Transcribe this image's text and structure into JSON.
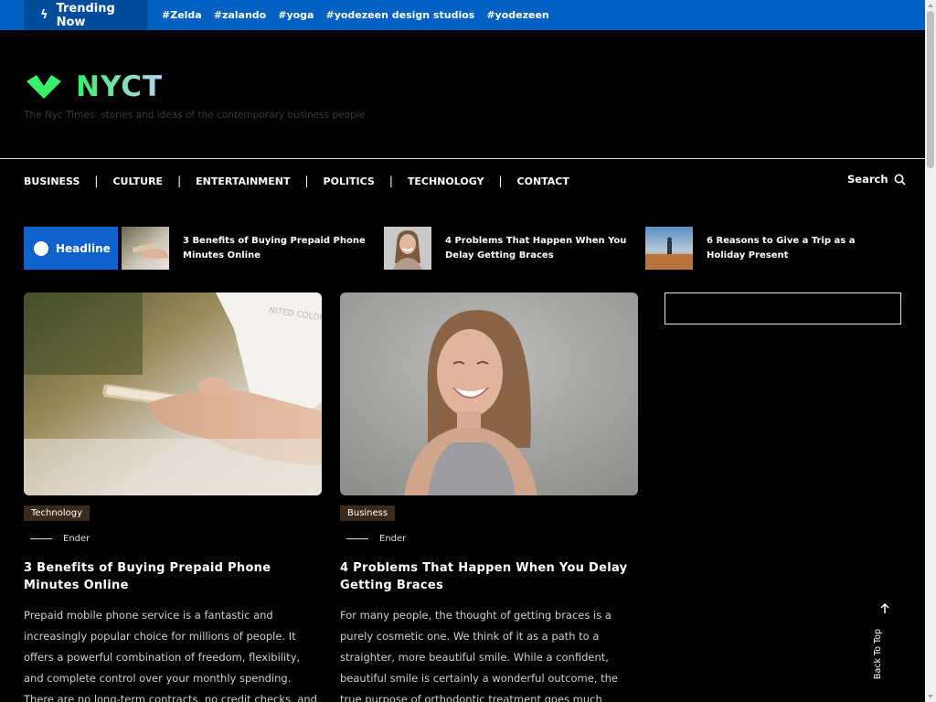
{
  "trending": {
    "label": "Trending Now",
    "tags": [
      "#Zelda",
      "#zalando",
      "#yoga",
      "#yodezeen design studios",
      "#yodezeen"
    ]
  },
  "site": {
    "name": "NYCT",
    "tagline": "The Nyc Times: stories and ideas of the contemporary business people",
    "brand_colors": {
      "green": "#37ef6b",
      "blue": "#0061c2"
    }
  },
  "nav": {
    "items": [
      "BUSINESS",
      "CULTURE",
      "ENTERTAINMENT",
      "POLITICS",
      "TECHNOLOGY",
      "CONTACT"
    ],
    "search_label": "Search"
  },
  "headline": {
    "label": "Headline",
    "items": [
      {
        "title": "3 Benefits of Buying Prepaid Phone Minutes Online",
        "thumb": "phone-in-hand"
      },
      {
        "title": "4 Problems That Happen When You Delay Getting Braces",
        "thumb": "smiling-woman"
      },
      {
        "title": "6 Reasons to Give a Trip as a Holiday Present",
        "thumb": "traveler-landscape"
      }
    ]
  },
  "posts": [
    {
      "category": "Technology",
      "author": "Ender",
      "title": "3 Benefits of Buying Prepaid Phone Minutes Online",
      "excerpt": "Prepaid mobile phone service is a fantastic and increasingly popular choice for millions of people. It offers a powerful combination of freedom, flexibility, and complete control over your monthly spending. There are no long-term contracts, no credit checks, and no surprise"
    },
    {
      "category": "Business",
      "author": "Ender",
      "title": "4 Problems That Happen When You Delay Getting Braces",
      "excerpt": "For many people, the thought of getting braces is a purely cosmetic one. We think of it as a path to a straighter, more beautiful smile. While a confident, beautiful smile is certainly a wonderful outcome, the true purpose of orthodontic treatment goes much deeper. It is about"
    }
  ],
  "back_to_top": "Back To Top"
}
